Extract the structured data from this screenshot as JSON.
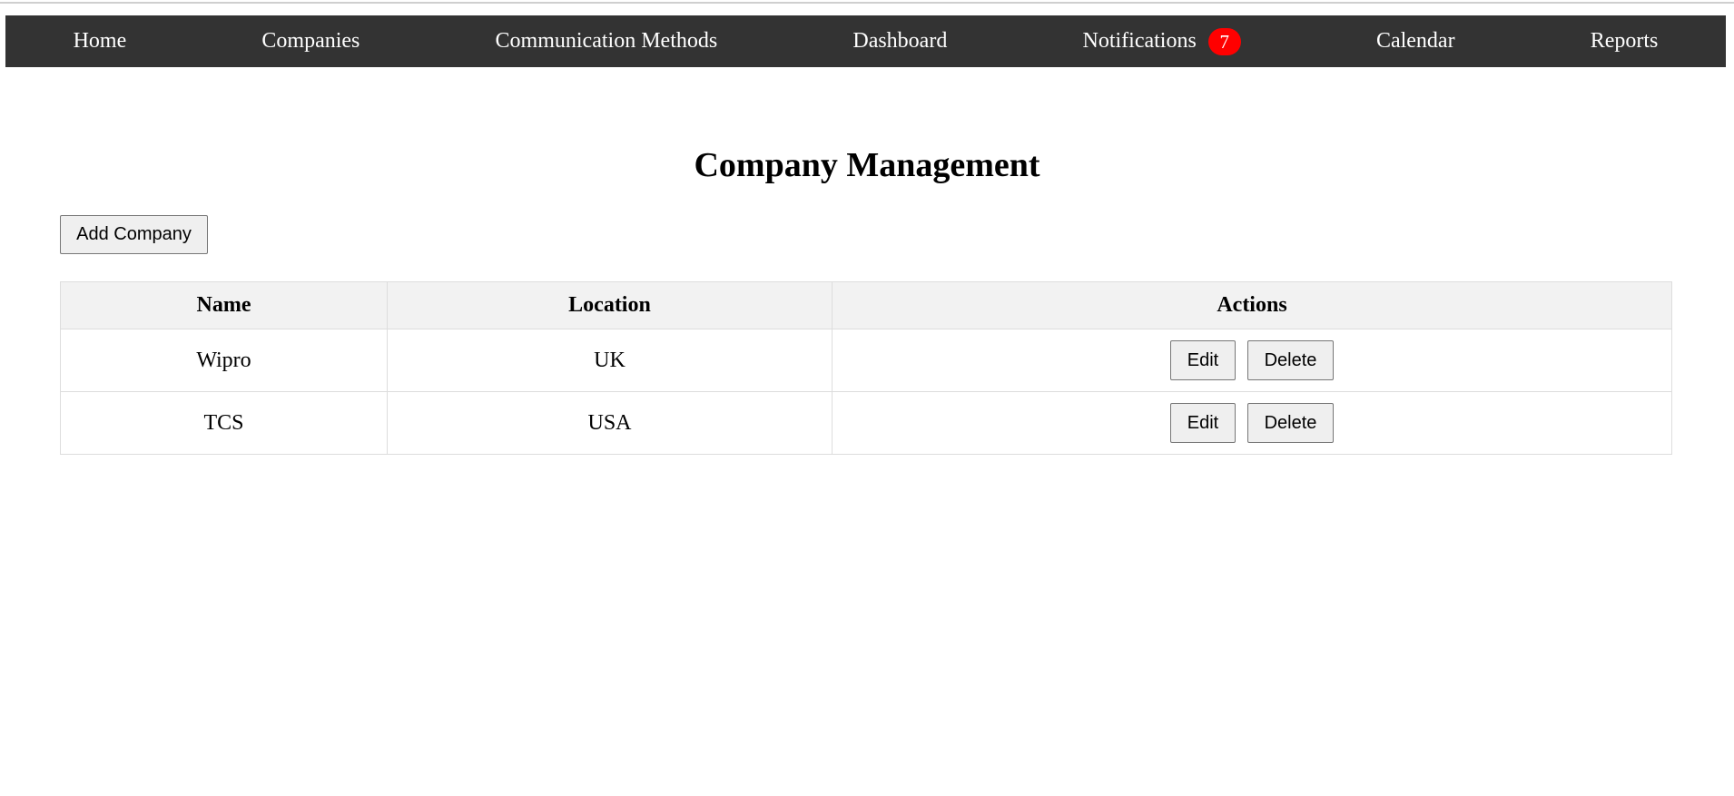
{
  "nav": {
    "items": [
      {
        "label": "Home"
      },
      {
        "label": "Companies"
      },
      {
        "label": "Communication Methods"
      },
      {
        "label": "Dashboard"
      },
      {
        "label": "Notifications",
        "badge": "7"
      },
      {
        "label": "Calendar"
      },
      {
        "label": "Reports"
      }
    ]
  },
  "colors": {
    "navbar_bg": "#333333",
    "badge_bg": "#ff0000"
  },
  "page": {
    "title": "Company Management",
    "add_button_label": "Add Company"
  },
  "table": {
    "headers": [
      "Name",
      "Location",
      "Actions"
    ],
    "rows": [
      {
        "name": "Wipro",
        "location": "UK",
        "edit_label": "Edit",
        "delete_label": "Delete"
      },
      {
        "name": "TCS",
        "location": "USA",
        "edit_label": "Edit",
        "delete_label": "Delete"
      }
    ]
  }
}
